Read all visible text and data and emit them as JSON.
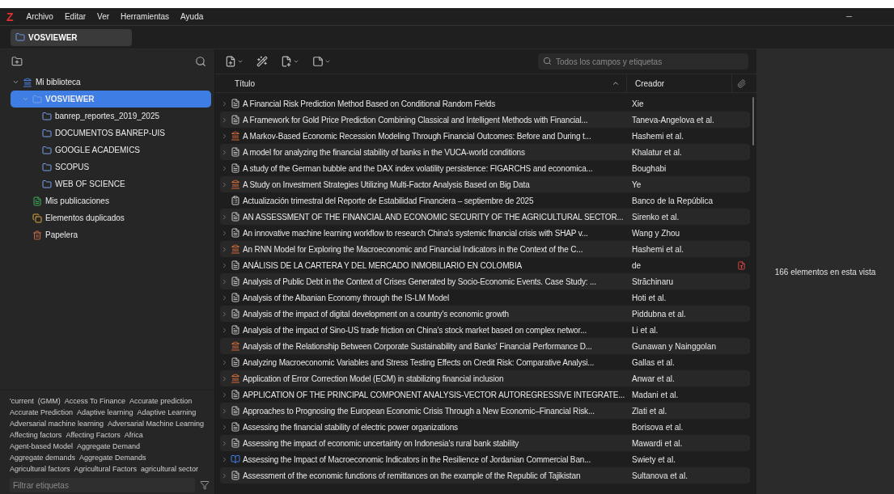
{
  "menu": {
    "logo": "Z",
    "items": [
      "Archivo",
      "Editar",
      "Ver",
      "Herramientas",
      "Ayuda"
    ]
  },
  "tabs": [
    {
      "label": "VOSVIEWER",
      "selected": true
    }
  ],
  "collections": [
    {
      "label": "Mi biblioteca",
      "kind": "library",
      "expanded": true,
      "selected": false,
      "children": [
        {
          "label": "VOSVIEWER",
          "kind": "folder",
          "expanded": true,
          "selected": true,
          "children": [
            {
              "label": "banrep_reportes_2019_2025",
              "kind": "folder",
              "selected": false
            },
            {
              "label": "DOCUMENTOS BANREP-UIS",
              "kind": "folder",
              "selected": false
            },
            {
              "label": "GOOGLE ACADEMICS",
              "kind": "folder",
              "selected": false
            },
            {
              "label": "SCOPUS",
              "kind": "folder",
              "selected": false
            },
            {
              "label": "WEB OF SCIENCE",
              "kind": "folder",
              "selected": false
            }
          ]
        },
        {
          "label": "Mis publicaciones",
          "kind": "publications",
          "selected": false
        },
        {
          "label": "Elementos duplicados",
          "kind": "duplicates",
          "selected": false
        },
        {
          "label": "Papelera",
          "kind": "trash",
          "selected": false
        }
      ]
    }
  ],
  "tag_rows": [
    [
      "'current",
      "(GMM)",
      "Access To Finance",
      "Accurate prediction"
    ],
    [
      "Accurate Prediction",
      "Adaptive learning",
      "Adaptive Learning"
    ],
    [
      "Adversarial machine learning",
      "Adversarial Machine Learning"
    ],
    [
      "Affecting factors",
      "Affecting Factors",
      "Africa"
    ],
    [
      "Agent-based Model",
      "Aggregate Demand"
    ],
    [
      "Aggregate demands",
      "Aggregate Demands"
    ],
    [
      "Agricultural factors",
      "Agricultural Factors",
      "agricultural sector"
    ]
  ],
  "tag_filter": {
    "placeholder": "Filtrar etiquetas"
  },
  "search": {
    "placeholder": "Todos los campos y etiquetas"
  },
  "table": {
    "columns": [
      {
        "label": "Título",
        "sorted": true
      },
      {
        "label": "Creador",
        "sorted": false
      }
    ],
    "rows": [
      {
        "title": "A Financial Risk Prediction Method Based on Conditional Random Fields",
        "creator": "Xie",
        "kind": "article",
        "expandable": true,
        "has_pdf": false
      },
      {
        "title": "A Framework for Gold Price Prediction Combining Classical and Intelligent Methods with Financial...",
        "creator": "Taneva-Angelova et al.",
        "kind": "article",
        "expandable": true,
        "has_pdf": false
      },
      {
        "title": "A Markov-Based Economic Recession Modeling Through Financial Outcomes: Before and During t...",
        "creator": "Hashemi et al.",
        "kind": "conference",
        "expandable": true,
        "has_pdf": false
      },
      {
        "title": "A model for analyzing the financial stability of banks in the VUCA-world conditions",
        "creator": "Khalatur et al.",
        "kind": "article",
        "expandable": true,
        "has_pdf": false
      },
      {
        "title": "A study of the German bubble and the DAX index volatility persistence: FIGARCHS and economica...",
        "creator": "Boughabi",
        "kind": "article",
        "expandable": true,
        "has_pdf": false
      },
      {
        "title": "A Study on Investment Strategies Utilizing Multi-Factor Analysis Based on Big Data",
        "creator": "Ye",
        "kind": "conference",
        "expandable": true,
        "has_pdf": false
      },
      {
        "title": "Actualización trimestral del Reporte de Estabilidad Financiera – septiembre de 2025",
        "creator": "Banco de la República",
        "kind": "report",
        "expandable": false,
        "has_pdf": false
      },
      {
        "title": "AN ASSESSMENT OF THE FINANCIAL AND ECONOMIC SECURITY OF THE AGRICULTURAL SECTOR...",
        "creator": "Sirenko et al.",
        "kind": "article",
        "expandable": true,
        "has_pdf": false
      },
      {
        "title": "An innovative machine learning workflow to research China's systemic financial crisis with SHAP v...",
        "creator": "Wang y Zhou",
        "kind": "article",
        "expandable": true,
        "has_pdf": false
      },
      {
        "title": "An RNN Model for Exploring the Macroeconomic and Financial Indicators in the Context of the C...",
        "creator": "Hashemi et al.",
        "kind": "conference",
        "expandable": true,
        "has_pdf": false
      },
      {
        "title": "ANÁLISIS DE LA CARTERA Y DEL MERCADO INMOBILIARIO EN COLOMBIA",
        "creator": "de",
        "kind": "article",
        "expandable": true,
        "has_pdf": true
      },
      {
        "title": "Analysis of Public Debt in the Context of Crises Generated by Socio-Economic Events. Case Study: ...",
        "creator": "Străchinaru",
        "kind": "article",
        "expandable": true,
        "has_pdf": false
      },
      {
        "title": "Analysis of the Albanian Economy through the IS-LM Model",
        "creator": "Hoti et al.",
        "kind": "article",
        "expandable": true,
        "has_pdf": false
      },
      {
        "title": "Analysis of the impact of digital development on a country's economic growth",
        "creator": "Piddubna et al.",
        "kind": "article",
        "expandable": true,
        "has_pdf": false
      },
      {
        "title": "Analysis of the impact of Sino-US trade friction on China's stock market based on complex networ...",
        "creator": "Li et al.",
        "kind": "article",
        "expandable": true,
        "has_pdf": false
      },
      {
        "title": "Analysis of the Relationship Between Corporate Sustainability and Banks' Financial Performance D...",
        "creator": "Gunawan y Nainggolan",
        "kind": "conference",
        "expandable": false,
        "has_pdf": false
      },
      {
        "title": "Analyzing Macroeconomic Variables and Stress Testing Effects on Credit Risk: Comparative Analysi...",
        "creator": "Gallas et al.",
        "kind": "article",
        "expandable": true,
        "has_pdf": false
      },
      {
        "title": "Application of Error Correction Model (ECM) in stabilizing financial inclusion",
        "creator": "Anwar et al.",
        "kind": "conference",
        "expandable": true,
        "has_pdf": false
      },
      {
        "title": "APPLICATION OF THE PRINCIPAL COMPONENT ANALYSIS-VECTOR AUTOREGRESSIVE INTEGRATE...",
        "creator": "Madani et al.",
        "kind": "article",
        "expandable": true,
        "has_pdf": false
      },
      {
        "title": "Approaches to Prognosing the European Economic Crisis Through a New Economic–Financial Risk...",
        "creator": "Zlati et al.",
        "kind": "article",
        "expandable": true,
        "has_pdf": false
      },
      {
        "title": "Assessing the financial stability of electric power organizations",
        "creator": "Borisova et al.",
        "kind": "article",
        "expandable": true,
        "has_pdf": false
      },
      {
        "title": "Assessing the impact of economic uncertainty on Indonesia's rural bank stability",
        "creator": "Mawardi et al.",
        "kind": "article",
        "expandable": true,
        "has_pdf": false
      },
      {
        "title": "Assessing the Impact of Macroeconomic Indicators in the Resilience of Jordanian Commercial Ban...",
        "creator": "Swiety et al.",
        "kind": "book",
        "expandable": true,
        "has_pdf": false
      },
      {
        "title": "Assessment of the economic functions of remittances on the example of the Republic of Tajikistan",
        "creator": "Sultanova et al.",
        "kind": "article",
        "expandable": true,
        "has_pdf": false
      }
    ]
  },
  "item_pane": {
    "message": "166 elementos en esta vista"
  }
}
